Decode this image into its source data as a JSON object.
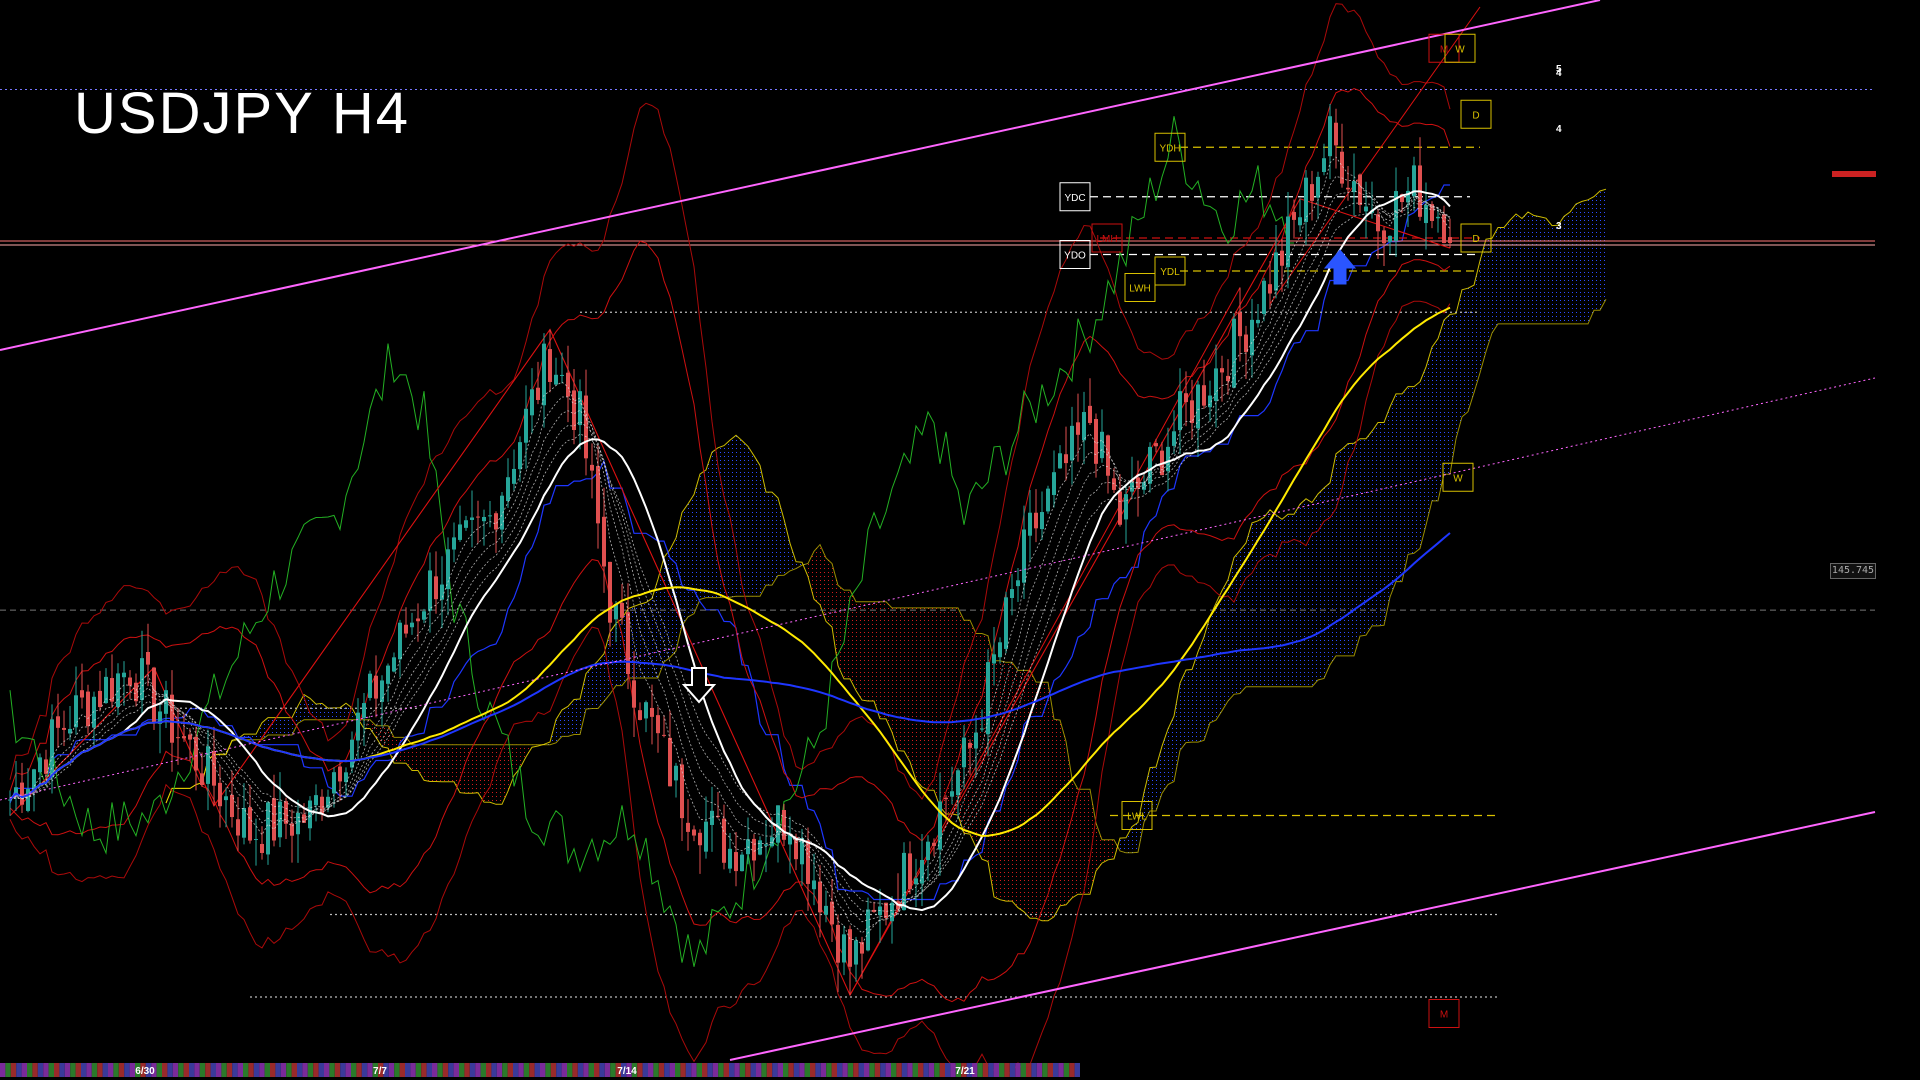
{
  "chart_title": "USDJPY H4",
  "price_marker": "145.745",
  "box_labels": {
    "ydh": "YDH",
    "ydc": "YDC",
    "ydo": "YDO",
    "ydl": "YDL",
    "lmh": "LMH",
    "lwh": "LWH",
    "lwl": "LWL",
    "m_top": "M",
    "w_top": "W",
    "d_1": "D",
    "d_2": "D",
    "w_mid": "W",
    "m_bottom": "M"
  },
  "right_numbers": [
    "5",
    "4",
    "4",
    "3"
  ],
  "chart_data": {
    "type": "line",
    "title": "USDJPY H4",
    "instrument": "USDJPY",
    "timeframe": "H4",
    "x_tick_labels": [
      "6/30",
      "7/7",
      "7/14",
      "7/21"
    ],
    "marked_price": 145.745,
    "close_path": [
      {
        "bar": 0,
        "close": 144.6
      },
      {
        "bar": 10,
        "close": 145.1
      },
      {
        "bar": 20,
        "close": 145.4
      },
      {
        "bar": 30,
        "close": 144.9
      },
      {
        "bar": 40,
        "close": 144.4
      },
      {
        "bar": 50,
        "close": 144.5
      },
      {
        "bar": 60,
        "close": 145.2
      },
      {
        "bar": 70,
        "close": 145.9
      },
      {
        "bar": 80,
        "close": 146.3
      },
      {
        "bar": 90,
        "close": 147.3
      },
      {
        "bar": 95,
        "close": 146.9
      },
      {
        "bar": 100,
        "close": 145.8
      },
      {
        "bar": 105,
        "close": 145.2
      },
      {
        "bar": 112,
        "close": 144.6
      },
      {
        "bar": 120,
        "close": 144.3
      },
      {
        "bar": 130,
        "close": 144.5
      },
      {
        "bar": 140,
        "close": 143.6
      },
      {
        "bar": 150,
        "close": 144.2
      },
      {
        "bar": 160,
        "close": 144.9
      },
      {
        "bar": 170,
        "close": 146.2
      },
      {
        "bar": 180,
        "close": 146.9
      },
      {
        "bar": 185,
        "close": 146.3
      },
      {
        "bar": 195,
        "close": 146.9
      },
      {
        "bar": 205,
        "close": 147.4
      },
      {
        "bar": 212,
        "close": 147.9
      },
      {
        "bar": 220,
        "close": 148.6
      },
      {
        "bar": 228,
        "close": 148.1
      },
      {
        "bar": 234,
        "close": 148.3
      },
      {
        "bar": 240,
        "close": 148.1
      }
    ],
    "levels": {
      "YDH": 148.55,
      "YDC": 148.25,
      "YDO": 147.9,
      "YDL": 147.8,
      "LMH": 148.0,
      "LWH": 147.7,
      "LWL": 144.5
    },
    "series": [
      {
        "name": "EMA white"
      },
      {
        "name": "EMA yellow"
      },
      {
        "name": "EMA blue"
      },
      {
        "name": "Ichimoku cloud"
      },
      {
        "name": "Bollinger Bands"
      },
      {
        "name": "Chikou span"
      }
    ]
  },
  "colors": {
    "background": "#000000",
    "bull": "#26a69a",
    "bear": "#e05050",
    "channel": "#ff66ff",
    "white_ma": "#ffffff",
    "yellow_ma": "#ffea00",
    "blue_ma": "#1e36ff",
    "cloud_blue": "#1a3aff",
    "cloud_red": "#c01818",
    "bollinger": "#cc1010",
    "chikou": "#23b023"
  }
}
